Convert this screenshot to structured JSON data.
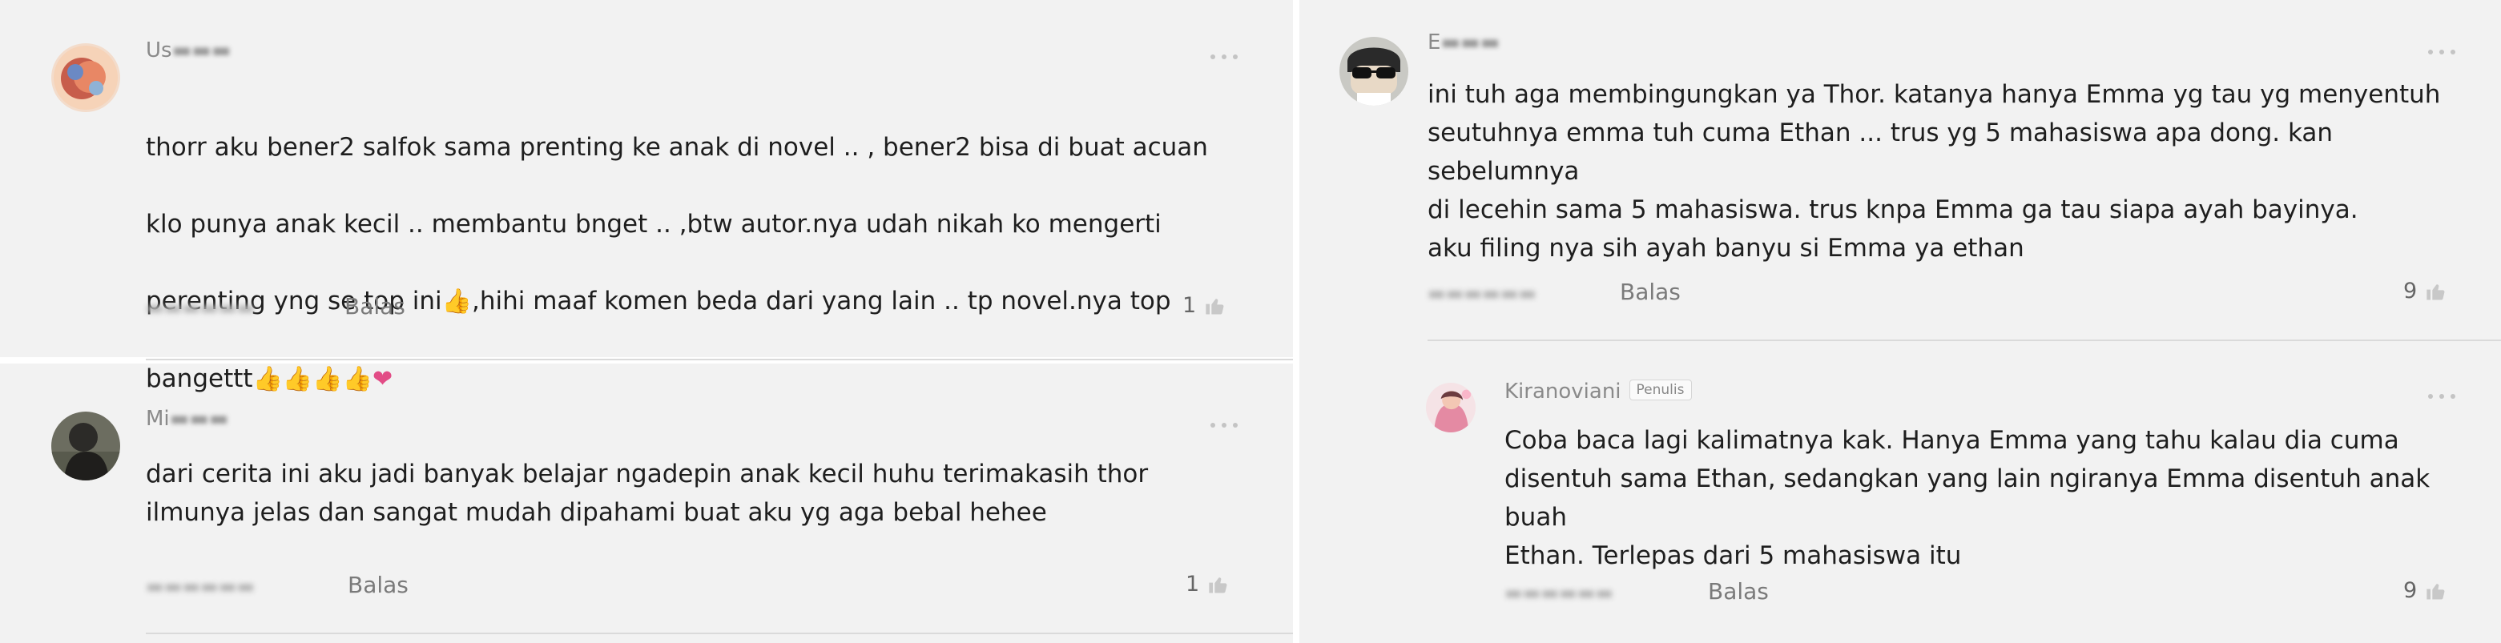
{
  "left_column": [
    {
      "avatar": "avatar-illustration",
      "username": "Us",
      "more_icon": "more-horizontal-icon",
      "text_lines": [
        "thorr aku bener2 salfok sama prenting ke anak di novel .. , bener2 bisa di buat acuan",
        "klo punya anak kecil .. membantu bnget .. ,btw autor.nya udah nikah ko mengerti",
        "perenting yng se top ini",
        ",hihi maaf komen beda dari yang lain .. tp novel.nya top",
        "bangettt"
      ],
      "emoji": [
        "👍",
        "👍",
        "👍",
        "👍",
        "👍"
      ],
      "heart": "❤",
      "reply_label": "Balas",
      "like_count": "1",
      "like_icon": "thumbs-up-icon"
    },
    {
      "avatar": "avatar-photo-dark",
      "username": "Mi",
      "more_icon": "more-horizontal-icon",
      "text": "dari cerita ini aku jadi banyak belajar ngadepin anak kecil huhu terimakasih thor\nilmunya jelas dan sangat mudah dipahami buat aku yg aga bebal hehee",
      "reply_label": "Balas",
      "like_count": "1",
      "like_icon": "thumbs-up-icon"
    }
  ],
  "right_column": [
    {
      "avatar": "avatar-sunglasses",
      "username": "E",
      "more_icon": "more-horizontal-icon",
      "text": "ini tuh aga membingungkan ya Thor. katanya hanya Emma yg tau yg menyentuh\nseutuhnya emma tuh cuma Ethan ... trus yg 5 mahasiswa apa dong. kan sebelumnya\ndi lecehin sama 5 mahasiswa. trus knpa Emma ga tau siapa ayah bayinya.\naku filing nya sih ayah banyu si Emma ya ethan",
      "reply_label": "Balas",
      "like_count": "9",
      "like_icon": "thumbs-up-icon"
    },
    {
      "avatar": "avatar-author",
      "username": "Kiranoviani",
      "badge": "Penulis",
      "more_icon": "more-horizontal-icon",
      "text": "Coba baca lagi kalimatnya kak. Hanya Emma yang tahu kalau dia cuma\ndisentuh sama Ethan, sedangkan yang lain ngiranya Emma disentuh anak buah\nEthan. Terlepas dari 5 mahasiswa itu",
      "reply_label": "Balas",
      "like_count": "9",
      "like_icon": "thumbs-up-icon"
    }
  ],
  "colors": {
    "panel_bg": "#f2f2f2",
    "text": "#1e1e1e",
    "muted": "#8a8a8a",
    "divider": "#dadada",
    "heart": "#e24c86",
    "thumb": "#e9a829"
  }
}
